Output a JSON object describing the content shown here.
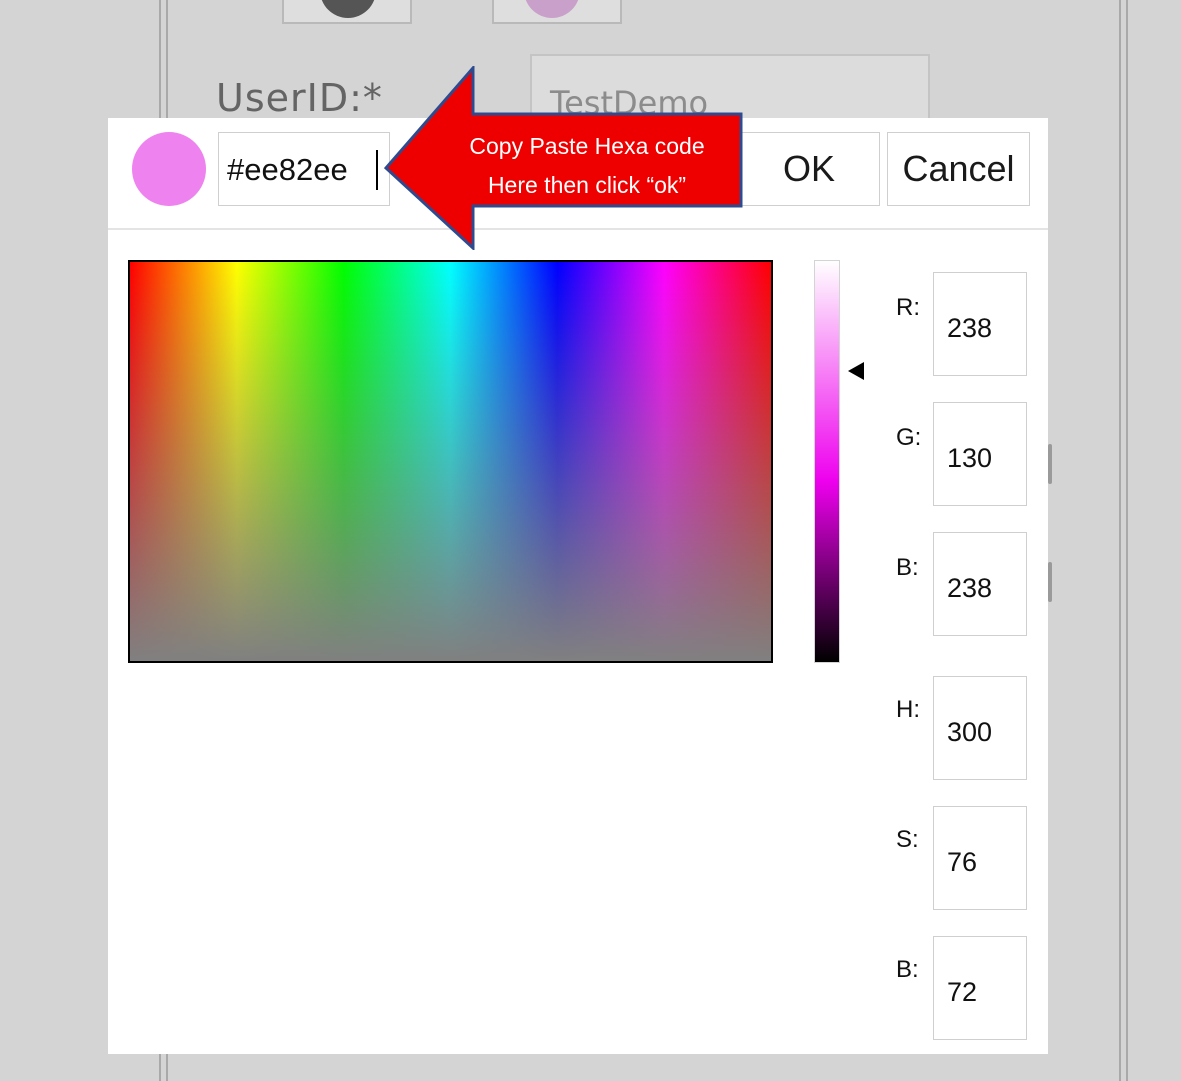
{
  "background_form": {
    "userid_label": "UserID:*",
    "userid_value": "TestDemo"
  },
  "color_picker": {
    "swatch_color": "#ee82ee",
    "hex_value": "#ee82ee",
    "ok_label": "OK",
    "cancel_label": "Cancel",
    "rgb": {
      "r_label": "R:",
      "r_value": "238",
      "g_label": "G:",
      "g_value": "130",
      "b_label": "B:",
      "b_value": "238"
    },
    "hsb": {
      "h_label": "H:",
      "h_value": "300",
      "s_label": "S:",
      "s_value": "76",
      "b_label": "B:",
      "b_value": "72"
    }
  },
  "annotation": {
    "line1": "Copy Paste Hexa code",
    "line2": "Here then click “ok”",
    "arrow_color": "#ee0000",
    "arrow_outline": "#2f4b8f"
  }
}
